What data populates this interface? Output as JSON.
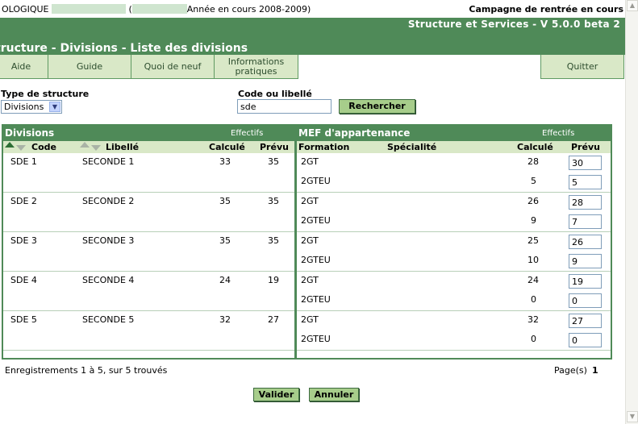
{
  "topbar": {
    "prefix": "OLOGIQUE",
    "paren_open": "(",
    "year_text": "Année en cours 2008-2009)",
    "campaign": "Campagne de rentrée en cours"
  },
  "header": {
    "app_version": "Structure et Services - V 5.0.0 beta 2",
    "page_title": "tructure - Divisions - Liste des divisions"
  },
  "menu": {
    "aide": "Aide",
    "guide": "Guide",
    "quoi_de_neuf": "Quoi de neuf",
    "informations_line1": "Informations",
    "informations_line2": "pratiques",
    "quitter": "Quitter"
  },
  "filters": {
    "type_label": "Type de structure",
    "type_value": "Divisions",
    "code_label": "Code ou libellé",
    "code_value": "sde",
    "search_button": "Rechercher"
  },
  "divisions": {
    "title": "Divisions",
    "effectifs": "Effectifs",
    "col_code": "Code",
    "col_libelle": "Libellé",
    "col_calcule": "Calculé",
    "col_prevu": "Prévu",
    "rows": [
      {
        "code": "SDE 1",
        "libelle": "SECONDE 1",
        "calcule": "33",
        "prevu": "35"
      },
      {
        "code": "SDE 2",
        "libelle": "SECONDE 2",
        "calcule": "35",
        "prevu": "35"
      },
      {
        "code": "SDE 3",
        "libelle": "SECONDE 3",
        "calcule": "35",
        "prevu": "35"
      },
      {
        "code": "SDE 4",
        "libelle": "SECONDE 4",
        "calcule": "24",
        "prevu": "19"
      },
      {
        "code": "SDE 5",
        "libelle": "SECONDE 5",
        "calcule": "32",
        "prevu": "27"
      }
    ]
  },
  "mef": {
    "title": "MEF d'appartenance",
    "effectifs": "Effectifs",
    "col_formation": "Formation",
    "col_specialite": "Spécialité",
    "col_calcule": "Calculé",
    "col_prevu": "Prévu",
    "rows": [
      {
        "formation": "2GT",
        "calcule": "28",
        "prevu": "30"
      },
      {
        "formation": "2GTEU",
        "calcule": "5",
        "prevu": "5"
      },
      {
        "formation": "2GT",
        "calcule": "26",
        "prevu": "28"
      },
      {
        "formation": "2GTEU",
        "calcule": "9",
        "prevu": "7"
      },
      {
        "formation": "2GT",
        "calcule": "25",
        "prevu": "26"
      },
      {
        "formation": "2GTEU",
        "calcule": "10",
        "prevu": "9"
      },
      {
        "formation": "2GT",
        "calcule": "24",
        "prevu": "19"
      },
      {
        "formation": "2GTEU",
        "calcule": "0",
        "prevu": "0"
      },
      {
        "formation": "2GT",
        "calcule": "32",
        "prevu": "27"
      },
      {
        "formation": "2GTEU",
        "calcule": "0",
        "prevu": "0"
      }
    ]
  },
  "footer": {
    "records": "Enregistrements 1 à 5, sur 5 trouvés",
    "pages_label": "Page(s)",
    "page_num": "1",
    "valider": "Valider",
    "annuler": "Annuler"
  },
  "colors": {
    "header_green": "#4f8a58",
    "menu_bg": "#d9e8c7",
    "button_bg": "#a7cd8b"
  }
}
